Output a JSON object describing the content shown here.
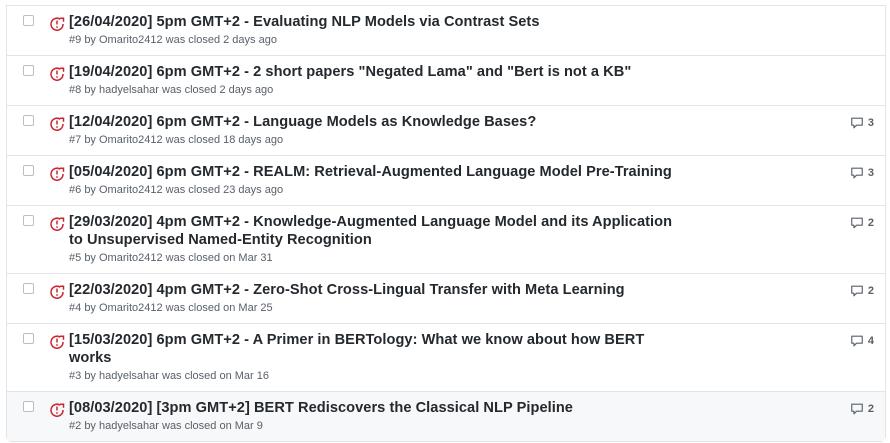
{
  "issues": [
    {
      "title": "[26/04/2020] 5pm GMT+2 - Evaluating NLP Models via Contrast Sets",
      "number": "#9",
      "by": "by",
      "author": "Omarito2412",
      "status": "was closed 2 days ago",
      "comments": ""
    },
    {
      "title": "[19/04/2020] 6pm GMT+2 - 2 short papers \"Negated Lama\" and \"Bert is not a KB\"",
      "number": "#8",
      "by": "by",
      "author": "hadyelsahar",
      "status": "was closed 2 days ago",
      "comments": ""
    },
    {
      "title": "[12/04/2020] 6pm GMT+2 - Language Models as Knowledge Bases?",
      "number": "#7",
      "by": "by",
      "author": "Omarito2412",
      "status": "was closed 18 days ago",
      "comments": "3"
    },
    {
      "title": "[05/04/2020] 6pm GMT+2 - REALM: Retrieval-Augmented Language Model Pre-Training",
      "number": "#6",
      "by": "by",
      "author": "Omarito2412",
      "status": "was closed 23 days ago",
      "comments": "3"
    },
    {
      "title": "[29/03/2020] 4pm GMT+2 - Knowledge-Augmented Language Model and its Application to Unsupervised Named-Entity Recognition",
      "number": "#5",
      "by": "by",
      "author": "Omarito2412",
      "status": "was closed on Mar 31",
      "comments": "2"
    },
    {
      "title": "[22/03/2020] 4pm GMT+2 - Zero-Shot Cross-Lingual Transfer with Meta Learning",
      "number": "#4",
      "by": "by",
      "author": "Omarito2412",
      "status": "was closed on Mar 25",
      "comments": "2"
    },
    {
      "title": "[15/03/2020] 6pm GMT+2 - A Primer in BERTology: What we know about how BERT works",
      "number": "#3",
      "by": "by",
      "author": "hadyelsahar",
      "status": "was closed on Mar 16",
      "comments": "4"
    },
    {
      "title": "[08/03/2020] [3pm GMT+2] BERT Rediscovers the Classical NLP Pipeline",
      "number": "#2",
      "by": "by",
      "author": "hadyelsahar",
      "status": "was closed on Mar 9",
      "comments": "2"
    }
  ],
  "colors": {
    "closed_icon": "#cb2431",
    "title": "#24292e",
    "meta": "#586069",
    "border": "#e1e4e8",
    "hover_bg": "#f6f8fa"
  },
  "icons": {
    "status": "issue-closed-icon",
    "comments": "comment-icon"
  }
}
